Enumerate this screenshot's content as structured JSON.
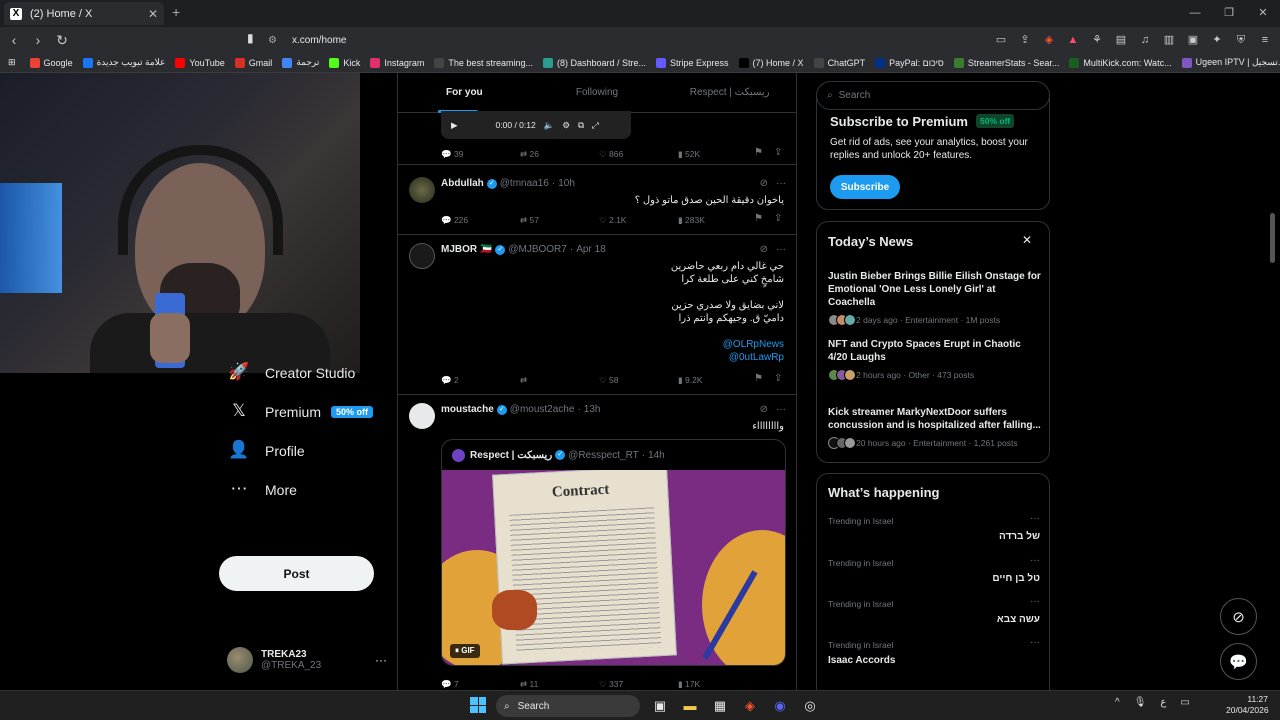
{
  "browser": {
    "tab_title": "(2) Home / X",
    "tab_favicon": "X",
    "url": "x.com/home",
    "bookmarks": [
      {
        "label": "Google",
        "icon": "google-icon",
        "color": "#ea4335"
      },
      {
        "label": "علامة تبويب جديدة",
        "icon": "facebook-icon",
        "color": "#1877f2"
      },
      {
        "label": "YouTube",
        "icon": "youtube-icon",
        "color": "#ff0000"
      },
      {
        "label": "Gmail",
        "icon": "gmail-icon",
        "color": "#d93025"
      },
      {
        "label": "ترجمة",
        "icon": "translate-icon",
        "color": "#4285f4"
      },
      {
        "label": "Kick",
        "icon": "kick-icon",
        "color": "#53fc18"
      },
      {
        "label": "Instagram",
        "icon": "instagram-icon",
        "color": "#e1306c"
      },
      {
        "label": "The best streaming...",
        "icon": "streaming-icon",
        "color": "#444444"
      },
      {
        "label": "(8) Dashboard / Stre...",
        "icon": "dashboard-icon",
        "color": "#2a9d8f"
      },
      {
        "label": "Stripe Express",
        "icon": "stripe-icon",
        "color": "#635bff"
      },
      {
        "label": "(7) Home / X",
        "icon": "x-icon",
        "color": "#000000"
      },
      {
        "label": "ChatGPT",
        "icon": "chatgpt-icon",
        "color": "#444444"
      },
      {
        "label": "PayPal: סיכום",
        "icon": "paypal-icon",
        "color": "#003087"
      },
      {
        "label": "StreamerStats - Sear...",
        "icon": "streamerstats-icon",
        "color": "#3a7d2c"
      },
      {
        "label": "MultiKick.com: Watc...",
        "icon": "multikick-icon",
        "color": "#1b5e20"
      },
      {
        "label": "Ugeen IPTV | تسجيل...",
        "icon": "ugeen-icon",
        "color": "#7e57c2"
      }
    ]
  },
  "leftnav": {
    "items": [
      {
        "label": "Creator Studio",
        "icon": "rocket-icon"
      },
      {
        "label": "Premium",
        "icon": "x-logo-icon",
        "badge": "50% off"
      },
      {
        "label": "Profile",
        "icon": "person-icon"
      },
      {
        "label": "More",
        "icon": "more-circle-icon"
      }
    ],
    "post_label": "Post",
    "account": {
      "name": "TREKA23",
      "handle": "@TREKA_23"
    }
  },
  "feed": {
    "tabs": [
      "For you",
      "Following",
      "Respect | ريسبكت"
    ],
    "video_time": "0:00 / 0:12",
    "tweet0_actions": {
      "replies": "39",
      "reposts": "26",
      "likes": "866",
      "views": "52K"
    },
    "tweets": [
      {
        "name": "Abdullah",
        "handle": "@tmnaa16",
        "time": "10h",
        "text": "ياخوان دقيقة الحين صدق ماتو ذول ؟",
        "actions": {
          "replies": "226",
          "reposts": "57",
          "likes": "2.1K",
          "views": "283K"
        }
      },
      {
        "name": "MJBOR 🇰🇼",
        "handle": "@MJBOOR7",
        "time": "Apr 18",
        "lines": [
          "حي غالي دام ربعي حاضرين",
          "شامخٍ كني على طلعة كرا",
          "",
          "لاني بضايق ولا صدري حزين",
          "داميّ ق. وجيهكم وانتم ذرا",
          "",
          "@OLRpNews",
          "@0utLawRp"
        ],
        "actions": {
          "replies": "2",
          "reposts": "",
          "likes": "58",
          "views": "9.2K"
        }
      },
      {
        "name": "moustache",
        "handle": "@moust2ache",
        "time": "13h",
        "text": "وااااااااء",
        "quote": {
          "name": "Respect | ريسبكت",
          "handle": "@Resspect_RT",
          "time": "14h",
          "gif_label": "GIF",
          "gif_text": "Contract"
        },
        "actions": {
          "replies": "7",
          "reposts": "11",
          "likes": "337",
          "views": "17K"
        }
      }
    ]
  },
  "sidebar": {
    "search_placeholder": "Search",
    "premium": {
      "title": "Subscribe to Premium",
      "badge": "50% off",
      "text": "Get rid of ads, see your analytics, boost your replies and unlock 20+ features.",
      "button": "Subscribe"
    },
    "news": {
      "title": "Today’s News",
      "items": [
        {
          "title": "Justin Bieber Brings Billie Eilish Onstage for Emotional 'One Less Lonely Girl' at Coachella",
          "meta": "2 days ago · Entertainment · 1M posts"
        },
        {
          "title": "NFT and Crypto Spaces Erupt in Chaotic 4/20 Laughs",
          "meta": "2 hours ago · Other · 473 posts"
        },
        {
          "title": "Kick streamer MarkyNextDoor suffers concussion and is hospitalized after falling...",
          "meta": "20 hours ago · Entertainment · 1,261 posts"
        }
      ]
    },
    "happening": {
      "title": "What’s happening",
      "trends": [
        {
          "context": "Trending in Israel",
          "topic": "של ברדה"
        },
        {
          "context": "Trending in Israel",
          "topic": "טל בן חיים"
        },
        {
          "context": "Trending in Israel",
          "topic": "עשה צבא"
        },
        {
          "context": "Trending in Israel",
          "topic": "Isaac Accords"
        }
      ]
    }
  },
  "taskbar": {
    "search": "Search",
    "time": "11:27",
    "date": "20/04/2026",
    "lang": "ع"
  }
}
